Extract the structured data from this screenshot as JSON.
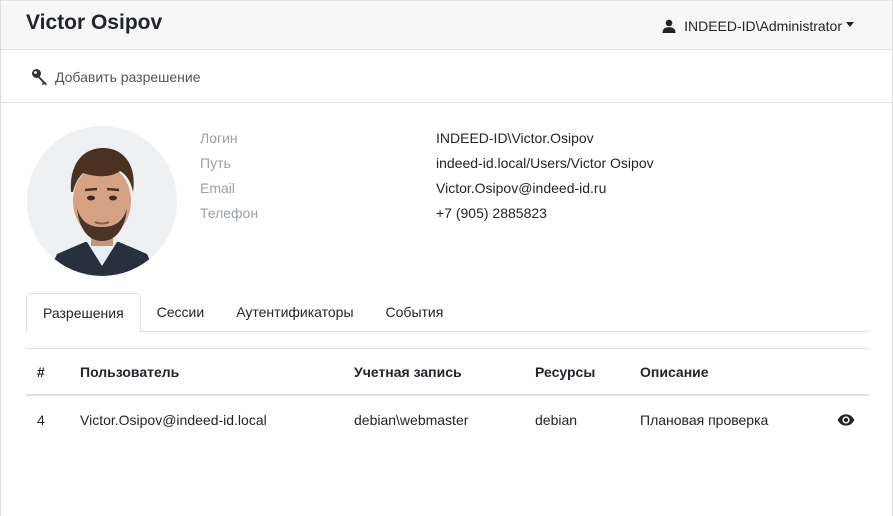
{
  "header": {
    "title": "Victor Osipov",
    "user": "INDEED-ID\\Administrator"
  },
  "toolbar": {
    "add_permission": "Добавить разрешение"
  },
  "profile": {
    "labels": [
      "Логин",
      "Путь",
      "Email",
      "Телефон"
    ],
    "values": [
      "INDEED-ID\\Victor.Osipov",
      "indeed-id.local/Users/Victor Osipov",
      "Victor.Osipov@indeed-id.ru",
      "+7 (905) 2885823"
    ]
  },
  "tabs": [
    "Разрешения",
    "Сессии",
    "Аутентификаторы",
    "События"
  ],
  "table": {
    "headers": [
      "#",
      "Пользователь",
      "Учетная запись",
      "Ресурсы",
      "Описание"
    ],
    "rows": [
      [
        "4",
        "Victor.Osipov@indeed-id.local",
        "debian\\webmaster",
        "debian",
        "Плановая проверка"
      ]
    ]
  },
  "icons": {
    "user": "user-icon",
    "key": "key-icon",
    "view": "eye-icon"
  },
  "colors": {
    "header_bg": "#f7f7f7",
    "border": "#dee2e6",
    "muted_label": "#9aa0a6"
  }
}
